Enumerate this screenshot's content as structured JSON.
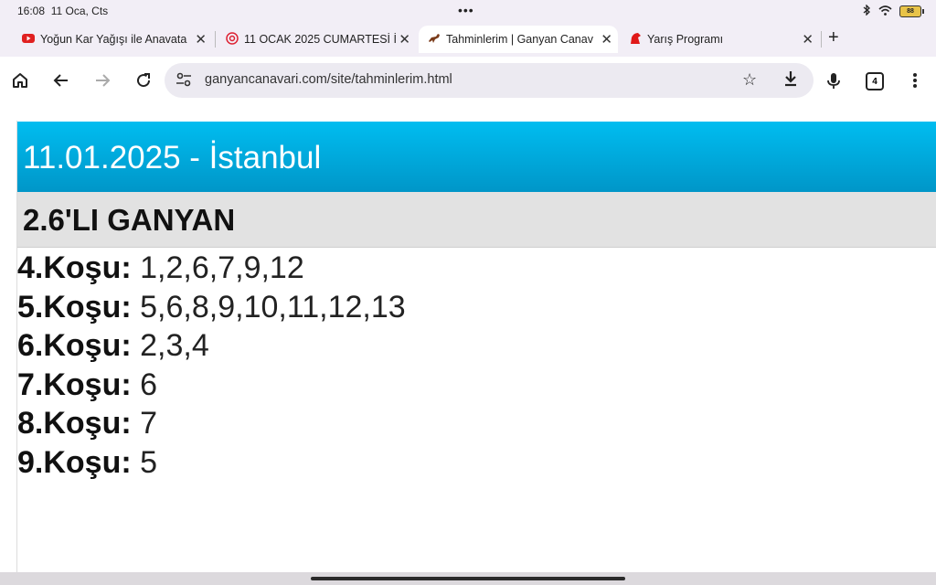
{
  "status": {
    "time": "16:08",
    "date": "11 Oca, Cts",
    "battery": "88",
    "icons": [
      "bluetooth-icon",
      "wifi-icon",
      "battery-icon"
    ]
  },
  "tabs": [
    {
      "title": "Yoğun Kar Yağışı ile Anavata",
      "icon": "youtube-icon",
      "active": false
    },
    {
      "title": "11 OCAK 2025 CUMARTESİ İ",
      "icon": "spinner-logo-icon",
      "active": false
    },
    {
      "title": "Tahminlerim | Ganyan Canav",
      "icon": "horse-icon",
      "active": true
    },
    {
      "title": "Yarış Programı",
      "icon": "red-horse-icon",
      "active": false
    }
  ],
  "toolbar": {
    "url": "ganyancanavari.com/site/tahminlerim.html",
    "tab_count": "4",
    "new_tab_label": "+",
    "icons": [
      "home-icon",
      "back-icon",
      "forward-icon",
      "reload-icon",
      "site-settings-icon",
      "bookmark-star-icon",
      "download-icon",
      "microphone-icon",
      "menu-icon"
    ]
  },
  "page": {
    "header_title": "11.01.2025 - İstanbul",
    "section_title": "2.6'LI GANYAN",
    "races": [
      {
        "label": "4.Koşu:",
        "value": "1,2,6,7,9,12"
      },
      {
        "label": "5.Koşu:",
        "value": "5,6,8,9,10,11,12,13"
      },
      {
        "label": "6.Koşu:",
        "value": "2,3,4"
      },
      {
        "label": "7.Koşu:",
        "value": "6"
      },
      {
        "label": "8.Koşu:",
        "value": "7"
      },
      {
        "label": "9.Koşu:",
        "value": "5"
      }
    ]
  }
}
